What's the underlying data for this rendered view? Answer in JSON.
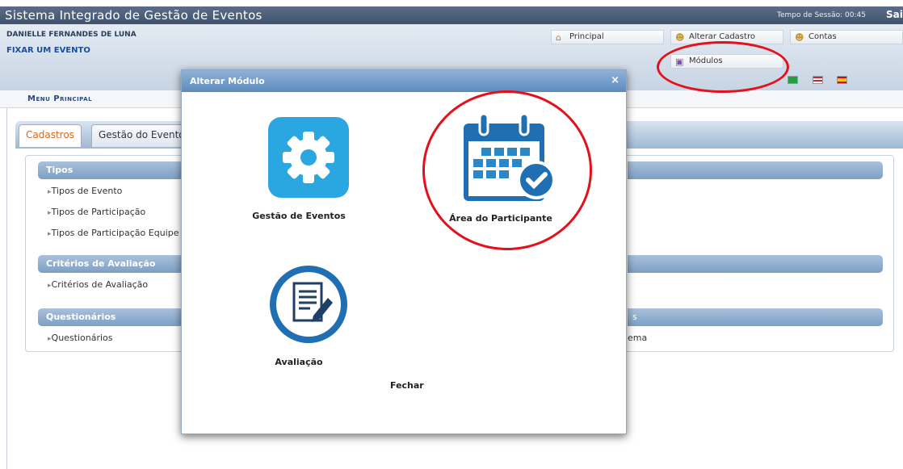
{
  "titlebar": {
    "title": "Sistema Integrado de Gestão de Eventos",
    "session_label": "Tempo de Sessão:",
    "session_time": "00:45",
    "exit": "Sai"
  },
  "header": {
    "user": "DANIELLE FERNANDES DE LUNA",
    "fix_event": "FIXAR UM EVENTO",
    "buttons": {
      "principal": "Principal",
      "alterar": "Alterar Cadastro",
      "contas": "Contas",
      "modulos": "Módulos"
    }
  },
  "menu": {
    "title": "Menu Principal"
  },
  "tabs": [
    "Cadastros",
    "Gestão do Evento"
  ],
  "sections": [
    {
      "title": "Tipos",
      "items": [
        "Tipos de Evento",
        "Tipos de Participação",
        "Tipos de Participação Equipe"
      ]
    },
    {
      "title": "Critérios de Avaliação",
      "items": [
        "Critérios de Avaliação"
      ]
    },
    {
      "title": "Questionários",
      "items": [
        "Questionários"
      ]
    }
  ],
  "right_fragments": {
    "s": "s",
    "ema": "ema"
  },
  "modal": {
    "title": "Alterar Módulo",
    "close": "×",
    "modules": [
      "Gestão de Eventos",
      "Área do Participante",
      "Avaliação"
    ],
    "fechar": "Fechar"
  },
  "colors": {
    "accent": "#2aa6e0",
    "highlight": "#e4101b",
    "bar": "#5c8bbf"
  }
}
